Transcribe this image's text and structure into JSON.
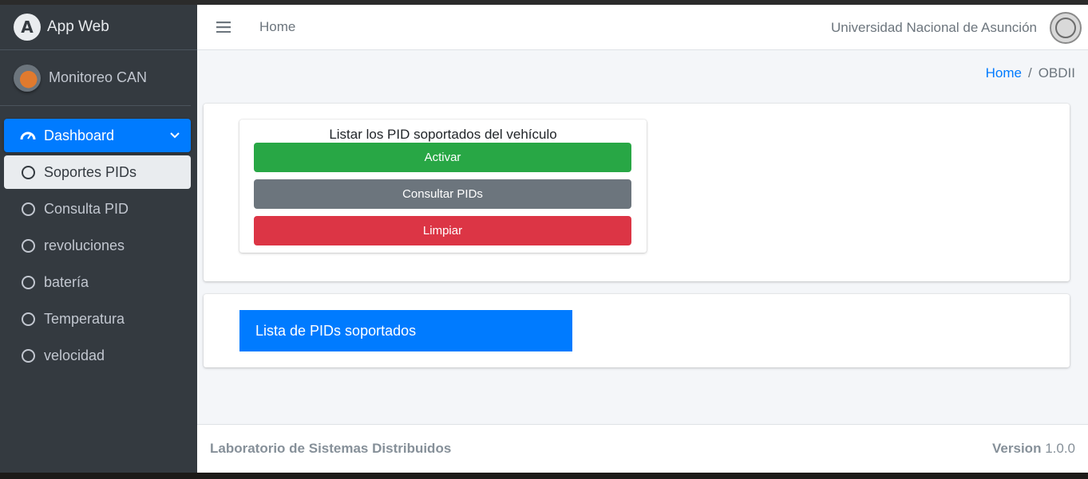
{
  "brand": {
    "title": "App Web"
  },
  "user_panel": {
    "name": "Monitoreo CAN"
  },
  "sidebar": {
    "items": [
      {
        "label": "Dashboard"
      },
      {
        "label": "Soportes PIDs"
      },
      {
        "label": "Consulta PID"
      },
      {
        "label": "revoluciones"
      },
      {
        "label": "batería"
      },
      {
        "label": "Temperatura"
      },
      {
        "label": "velocidad"
      }
    ]
  },
  "navbar": {
    "home": "Home",
    "institution": "Universidad Nacional de Asunción"
  },
  "breadcrumb": {
    "home": "Home",
    "separator": "/",
    "current": "OBDII"
  },
  "pid_panel": {
    "title": "Listar los PID soportados del vehículo",
    "activate": "Activar",
    "query": "Consultar PIDs",
    "clear": "Limpiar"
  },
  "pid_list": {
    "header": "Lista de PIDs soportados"
  },
  "footer": {
    "left": "Laboratorio de Sistemas Distribuidos",
    "version_label": "Version",
    "version_value": "1.0.0"
  },
  "colors": {
    "sidebar_bg": "#343a40",
    "primary": "#007bff",
    "success": "#28a745",
    "secondary": "#6c757d",
    "danger": "#dc3545"
  },
  "icons": {
    "brand": "brand-logo-icon",
    "menu": "hamburger-icon",
    "dashboard": "tachometer-icon",
    "submenu_item": "circle-outline-icon",
    "expand": "chevron-down-icon",
    "seal": "university-seal-icon"
  }
}
